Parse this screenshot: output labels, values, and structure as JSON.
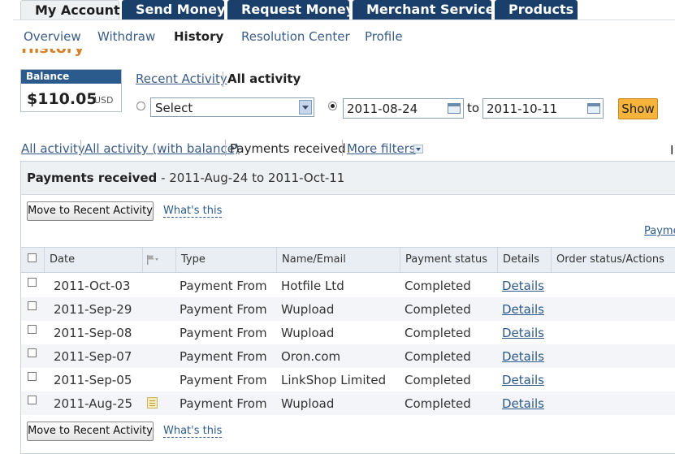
{
  "tabs": [
    "My Account",
    "Send Money",
    "Request Money",
    "Merchant Services",
    "Products"
  ],
  "subnav": [
    "Overview",
    "Withdraw",
    "History",
    "Resolution Center",
    "Profile"
  ],
  "page_title": "History",
  "balance": {
    "label": "Balance",
    "amount": "$110.05",
    "currency": "USD"
  },
  "view": {
    "recent": "Recent Activity",
    "all": "All activity"
  },
  "date_filter": {
    "select_value": "Select",
    "from": "2011-08-24",
    "to_label": "to",
    "to": "2011-10-11",
    "show": "Show"
  },
  "filters": {
    "all": "All activity",
    "all_balance": "All activity (with balance)",
    "payments_received": "Payments received",
    "more": "More filters",
    "edge_text": "I"
  },
  "panel": {
    "title_bold": "Payments received",
    "title_range": " - 2011-Aug-24 to 2011-Oct-11",
    "move_button": "Move to Recent Activity",
    "whats_this": "What's this",
    "payments_link": "Payme"
  },
  "columns": {
    "date": "Date",
    "type": "Type",
    "name": "Name/Email",
    "status": "Payment status",
    "details": "Details",
    "order": "Order status/Actions"
  },
  "rows": [
    {
      "date": "2011-Oct-03",
      "type": "Payment From",
      "name": "Hotfile Ltd",
      "status": "Completed",
      "details": "Details"
    },
    {
      "date": "2011-Sep-29",
      "type": "Payment From",
      "name": "Wupload",
      "status": "Completed",
      "details": "Details"
    },
    {
      "date": "2011-Sep-08",
      "type": "Payment From",
      "name": "Wupload",
      "status": "Completed",
      "details": "Details"
    },
    {
      "date": "2011-Sep-07",
      "type": "Payment From",
      "name": "Oron.com",
      "status": "Completed",
      "details": "Details"
    },
    {
      "date": "2011-Sep-05",
      "type": "Payment From",
      "name": "LinkShop Limited",
      "status": "Completed",
      "details": "Details"
    },
    {
      "date": "2011-Aug-25",
      "type": "Payment From",
      "name": "Wupload",
      "status": "Completed",
      "details": "Details"
    }
  ]
}
